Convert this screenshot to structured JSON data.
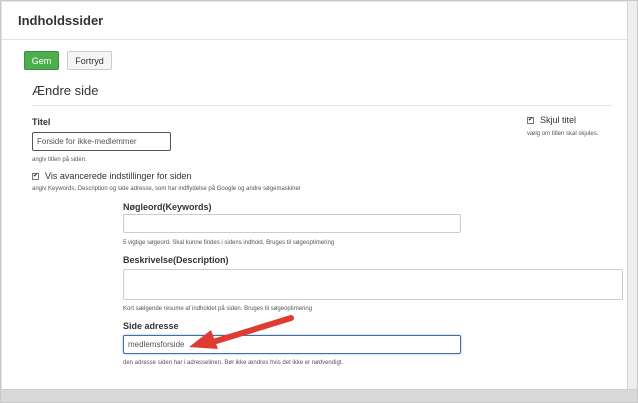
{
  "header": {
    "title": "Indholdssider"
  },
  "toolbar": {
    "save_label": "Gem",
    "cancel_label": "Fortryd"
  },
  "form": {
    "section_title": "Ændre side",
    "title_label": "Titel",
    "title_value": "Forside for ikke-medlemmer",
    "title_help": "angiv titlen på siden.",
    "hide_title_label": "Skjul titel",
    "hide_title_help": "vælg om titlen skal skjules.",
    "hide_title_checked": true,
    "advanced_label": "Vis avancerede indstillinger for siden",
    "advanced_checked": true,
    "advanced_help": "angiv Keywords, Description og side adresse, som har indflydelse på Google og andre søgemaskiner",
    "keywords_label": "Nøgleord(Keywords)",
    "keywords_value": "",
    "keywords_help": "5 vigtige søgeord. Skal kunne findes i sidens indhold. Bruges til søgeoptimering",
    "description_label": "Beskrivelse(Description)",
    "description_value": "",
    "description_help": "Kort sælgende resume af indholdet på siden. Bruges til søgeoptimering",
    "address_label": "Side adresse",
    "address_value": "medlemsforside",
    "address_help": "den adresse siden har i adresselinen. Bør ikke ændres hvis det ikke er nødvendigt."
  },
  "icons": {
    "check": "checkmark-icon",
    "arrow": "red-pointer-arrow-icon"
  },
  "colors": {
    "save_button": "#4cae4c",
    "arrow": "#e03b32",
    "focus_border": "#3c6fa6"
  }
}
